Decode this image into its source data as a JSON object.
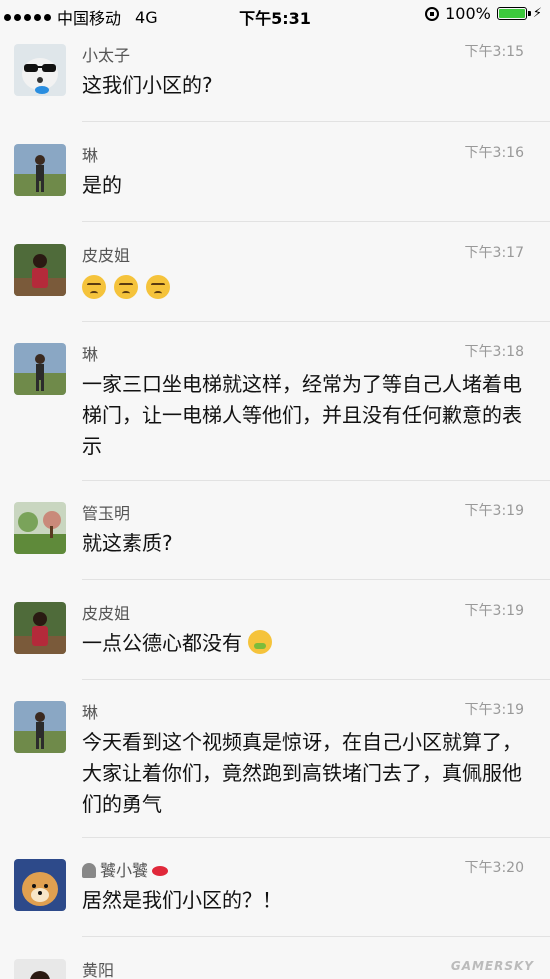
{
  "status_bar": {
    "carrier": "中国移动",
    "network": "4G",
    "time": "下午5:31",
    "battery": "100%",
    "battery_level": 1.0,
    "battery_color": "#3cc93c"
  },
  "messages": [
    {
      "name": "小太子",
      "time": "下午3:15",
      "text": "这我们小区的?"
    },
    {
      "name": "琳",
      "time": "下午3:16",
      "text": "是的"
    },
    {
      "name": "皮皮姐",
      "time": "下午3:17",
      "text": ""
    },
    {
      "name": "琳",
      "time": "下午3:18",
      "text": "一家三口坐电梯就这样，经常为了等自己人堵着电梯门，让一电梯人等他们，并且没有任何歉意的表示"
    },
    {
      "name": "管玉明",
      "time": "下午3:19",
      "text": "就这素质?"
    },
    {
      "name": "皮皮姐",
      "time": "下午3:19",
      "text": "一点公德心都没有"
    },
    {
      "name": "琳",
      "time": "下午3:19",
      "text": "今天看到这个视频真是惊讶，在自己小区就算了，大家让着你们，竟然跑到高铁堵门去了，真佩服他们的勇气"
    },
    {
      "name": "饕小饕",
      "time": "下午3:20",
      "text": "居然是我们小区的？！"
    },
    {
      "name": "黄阳",
      "time": "",
      "text": ""
    }
  ],
  "watermark": "GAMERSKY"
}
